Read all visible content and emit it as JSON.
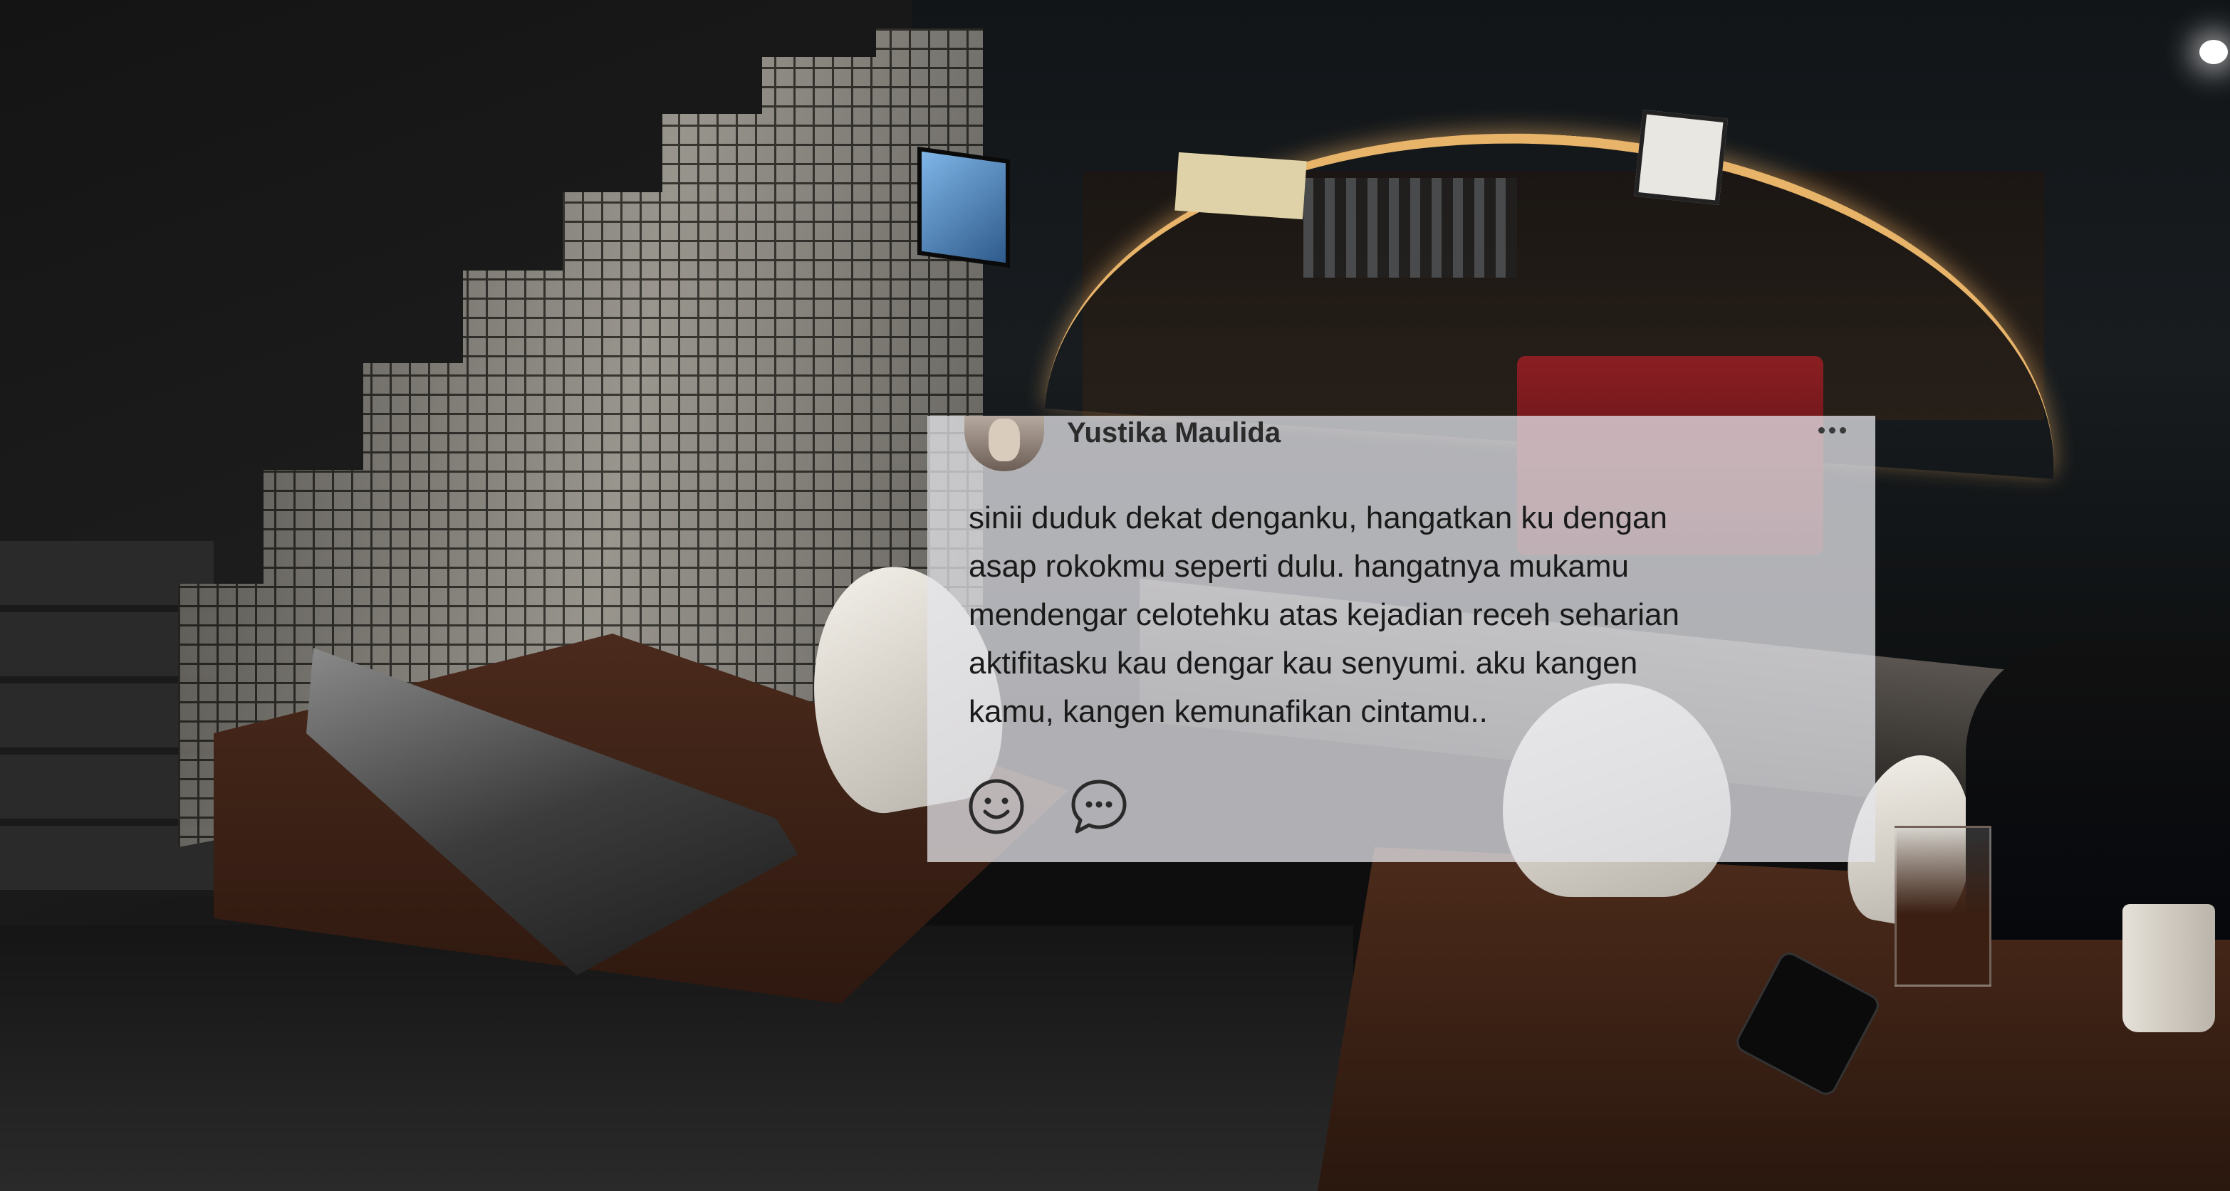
{
  "post": {
    "author_name": "Yustika Maulida",
    "more_menu_icon": "more-horizontal-icon",
    "body_lines": [
      "sinii duduk dekat denganku, hangatkan ku dengan",
      "asap rokokmu seperti dulu. hangatnya mukamu",
      "mendengar celotehku atas kejadian receh seharian",
      "aktifitasku kau dengar kau senyumi. aku kangen",
      "kamu, kangen kemunafikan cintamu.."
    ],
    "actions": {
      "react_icon": "smile-icon",
      "comment_icon": "comment-icon"
    },
    "card_background": "#e4e4e8"
  }
}
